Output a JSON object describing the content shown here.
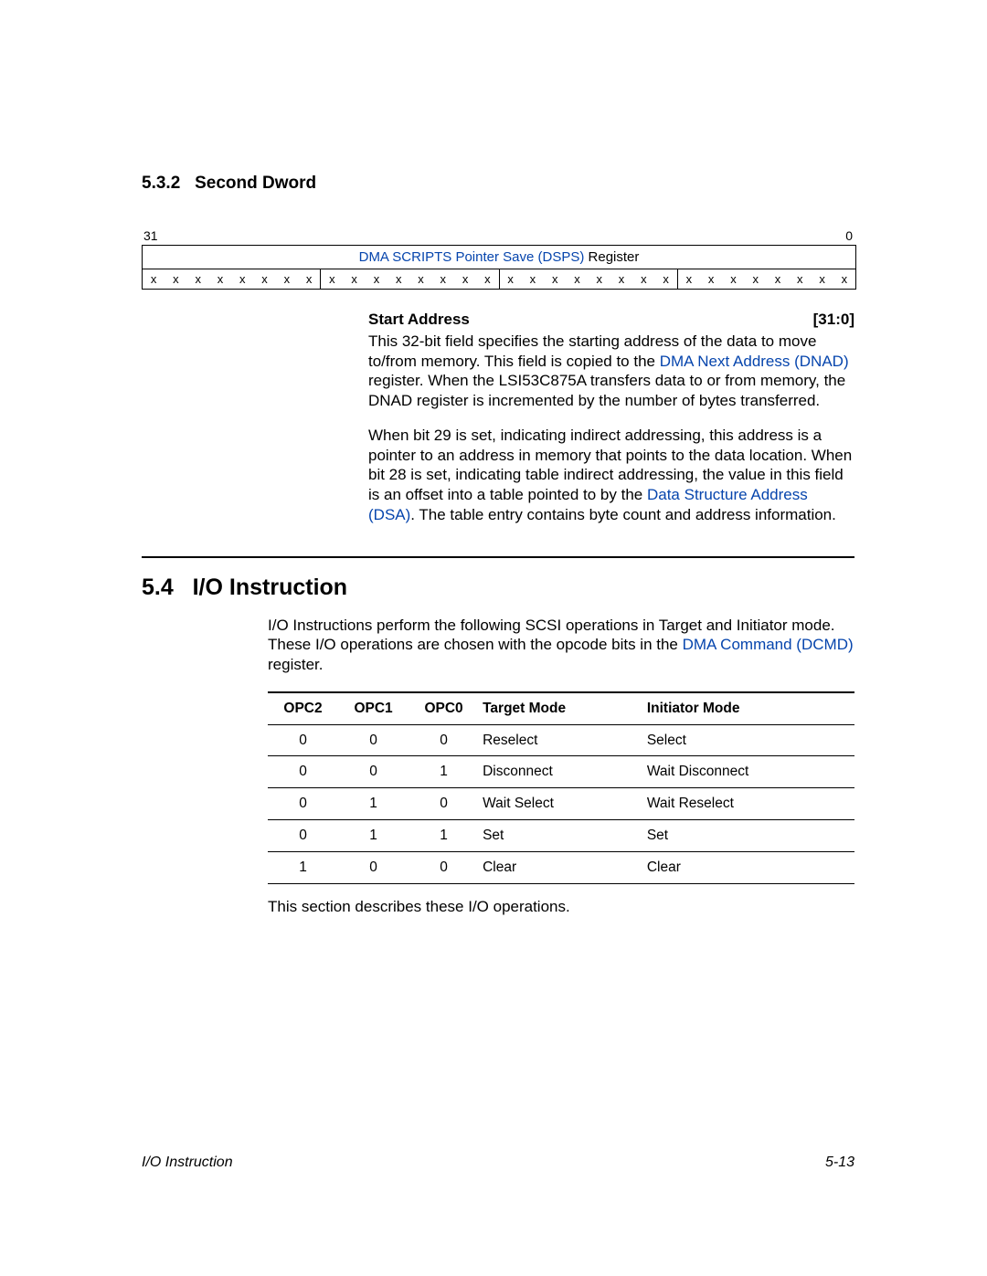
{
  "section_sub": {
    "num": "5.3.2",
    "title": "Second Dword"
  },
  "bitrange": {
    "hi": "31",
    "lo": "0"
  },
  "register": {
    "link": "DMA SCRIPTS Pointer Save (DSPS)",
    "suffix": " Register"
  },
  "bits_fill": "x",
  "field": {
    "name": "Start Address",
    "range": "[31:0]",
    "p1a": "This 32-bit field specifies the starting address of the data to move to/from memory. This field is copied to the ",
    "p1link": "DMA Next Address (DNAD)",
    "p1b": " register. When the LSI53C875A transfers data to or from memory, the DNAD register is incremented by the number of bytes transferred.",
    "p2a": "When bit 29 is set, indicating indirect addressing, this address is a pointer to an address in memory that points to the data location. When bit 28 is set, indicating table indirect addressing, the value in this field is an offset into a table pointed to by the ",
    "p2link": "Data Structure Address (DSA)",
    "p2b": ". The table entry contains byte count and address information."
  },
  "section_main": {
    "num": "5.4",
    "title": "I/O Instruction"
  },
  "intro": {
    "a": "I/O Instructions perform the following SCSI operations in Target and Initiator mode. These I/O operations are chosen with the opcode bits in the ",
    "link": "DMA Command (DCMD)",
    "b": " register."
  },
  "table": {
    "headers": [
      "OPC2",
      "OPC1",
      "OPC0",
      "Target Mode",
      "Initiator Mode"
    ],
    "rows": [
      [
        "0",
        "0",
        "0",
        "Reselect",
        "Select"
      ],
      [
        "0",
        "0",
        "1",
        "Disconnect",
        "Wait Disconnect"
      ],
      [
        "0",
        "1",
        "0",
        "Wait Select",
        "Wait Reselect"
      ],
      [
        "0",
        "1",
        "1",
        "Set",
        "Set"
      ],
      [
        "1",
        "0",
        "0",
        "Clear",
        "Clear"
      ]
    ]
  },
  "outro": "This section describes these I/O operations.",
  "footer": {
    "left": "I/O Instruction",
    "right": "5-13"
  }
}
